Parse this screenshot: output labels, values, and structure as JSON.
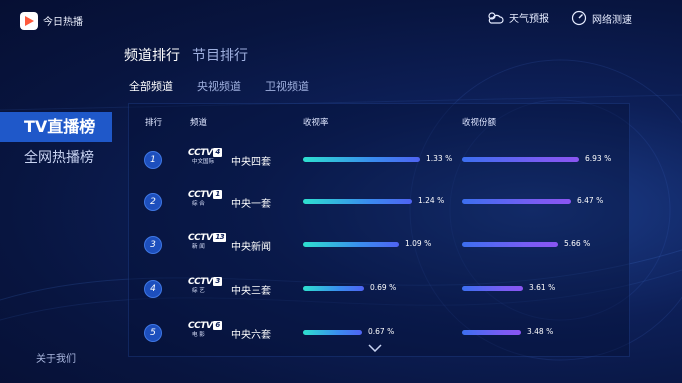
{
  "app": {
    "title": "今日热播"
  },
  "header": {
    "weather_label": "天气预报",
    "network_label": "网络测速"
  },
  "sidebar": {
    "items": [
      {
        "label": "TV直播榜"
      },
      {
        "label": "全网热播榜"
      }
    ],
    "about_label": "关于我们"
  },
  "main_tabs": [
    {
      "label": "频道排行"
    },
    {
      "label": "节目排行"
    }
  ],
  "sub_tabs": [
    {
      "label": "全部频道"
    },
    {
      "label": "央视频道"
    },
    {
      "label": "卫视频道"
    }
  ],
  "table": {
    "headers": {
      "rank": "排行",
      "channel": "频道",
      "rating": "收视率",
      "share": "收视份额"
    },
    "rows": [
      {
        "rank": "1",
        "logo_text": "CCTV",
        "logo_num": "4",
        "logo_sub": "中文国际",
        "name": "中央四套",
        "rating": 1.33,
        "rating_label": "1.33 %",
        "share": 6.93,
        "share_label": "6.93 %"
      },
      {
        "rank": "2",
        "logo_text": "CCTV",
        "logo_num": "1",
        "logo_sub": "综 合",
        "name": "中央一套",
        "rating": 1.24,
        "rating_label": "1.24 %",
        "share": 6.47,
        "share_label": "6.47 %"
      },
      {
        "rank": "3",
        "logo_text": "CCTV",
        "logo_num": "13",
        "logo_sub": "新 闻",
        "name": "中央新闻",
        "rating": 1.09,
        "rating_label": "1.09 %",
        "share": 5.66,
        "share_label": "5.66 %"
      },
      {
        "rank": "4",
        "logo_text": "CCTV",
        "logo_num": "3",
        "logo_sub": "综 艺",
        "name": "中央三套",
        "rating": 0.69,
        "rating_label": "0.69 %",
        "share": 3.61,
        "share_label": "3.61 %"
      },
      {
        "rank": "5",
        "logo_text": "CCTV",
        "logo_num": "6",
        "logo_sub": "电 影",
        "name": "中央六套",
        "rating": 0.67,
        "rating_label": "0.67 %",
        "share": 3.48,
        "share_label": "3.48 %"
      }
    ]
  },
  "colors": {
    "accent": "#1f58c9",
    "background": "#0d1f57",
    "rating_bar": "#2ee0cf",
    "share_bar": "#7a5cf3"
  }
}
